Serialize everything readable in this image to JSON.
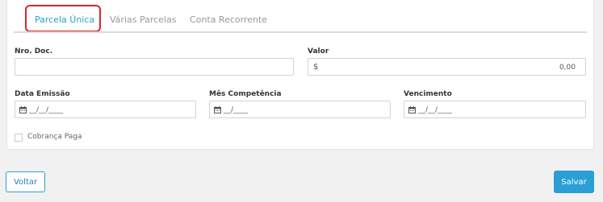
{
  "tabs": [
    {
      "label": "Parcela Única",
      "active": true
    },
    {
      "label": "Várias Parcelas",
      "active": false
    },
    {
      "label": "Conta Recorrente",
      "active": false
    }
  ],
  "form": {
    "nro_doc": {
      "label": "Nro. Doc.",
      "value": ""
    },
    "valor": {
      "label": "Valor",
      "prefix": "$",
      "value": "0,00"
    },
    "data_emissao": {
      "label": "Data Emissão",
      "placeholder": "__/__/____"
    },
    "mes_competencia": {
      "label": "Mês Competência",
      "placeholder": "__/____"
    },
    "vencimento": {
      "label": "Vencimento",
      "placeholder": "__/__/____"
    },
    "cobranca_paga": {
      "label": "Cobrança Paga",
      "checked": false
    }
  },
  "footer": {
    "back_label": "Voltar",
    "save_label": "Salvar"
  },
  "colors": {
    "accent": "#2a9fd6",
    "highlight": "#d9262c"
  },
  "icons": {
    "date_field_icon": "calendar-icon"
  }
}
